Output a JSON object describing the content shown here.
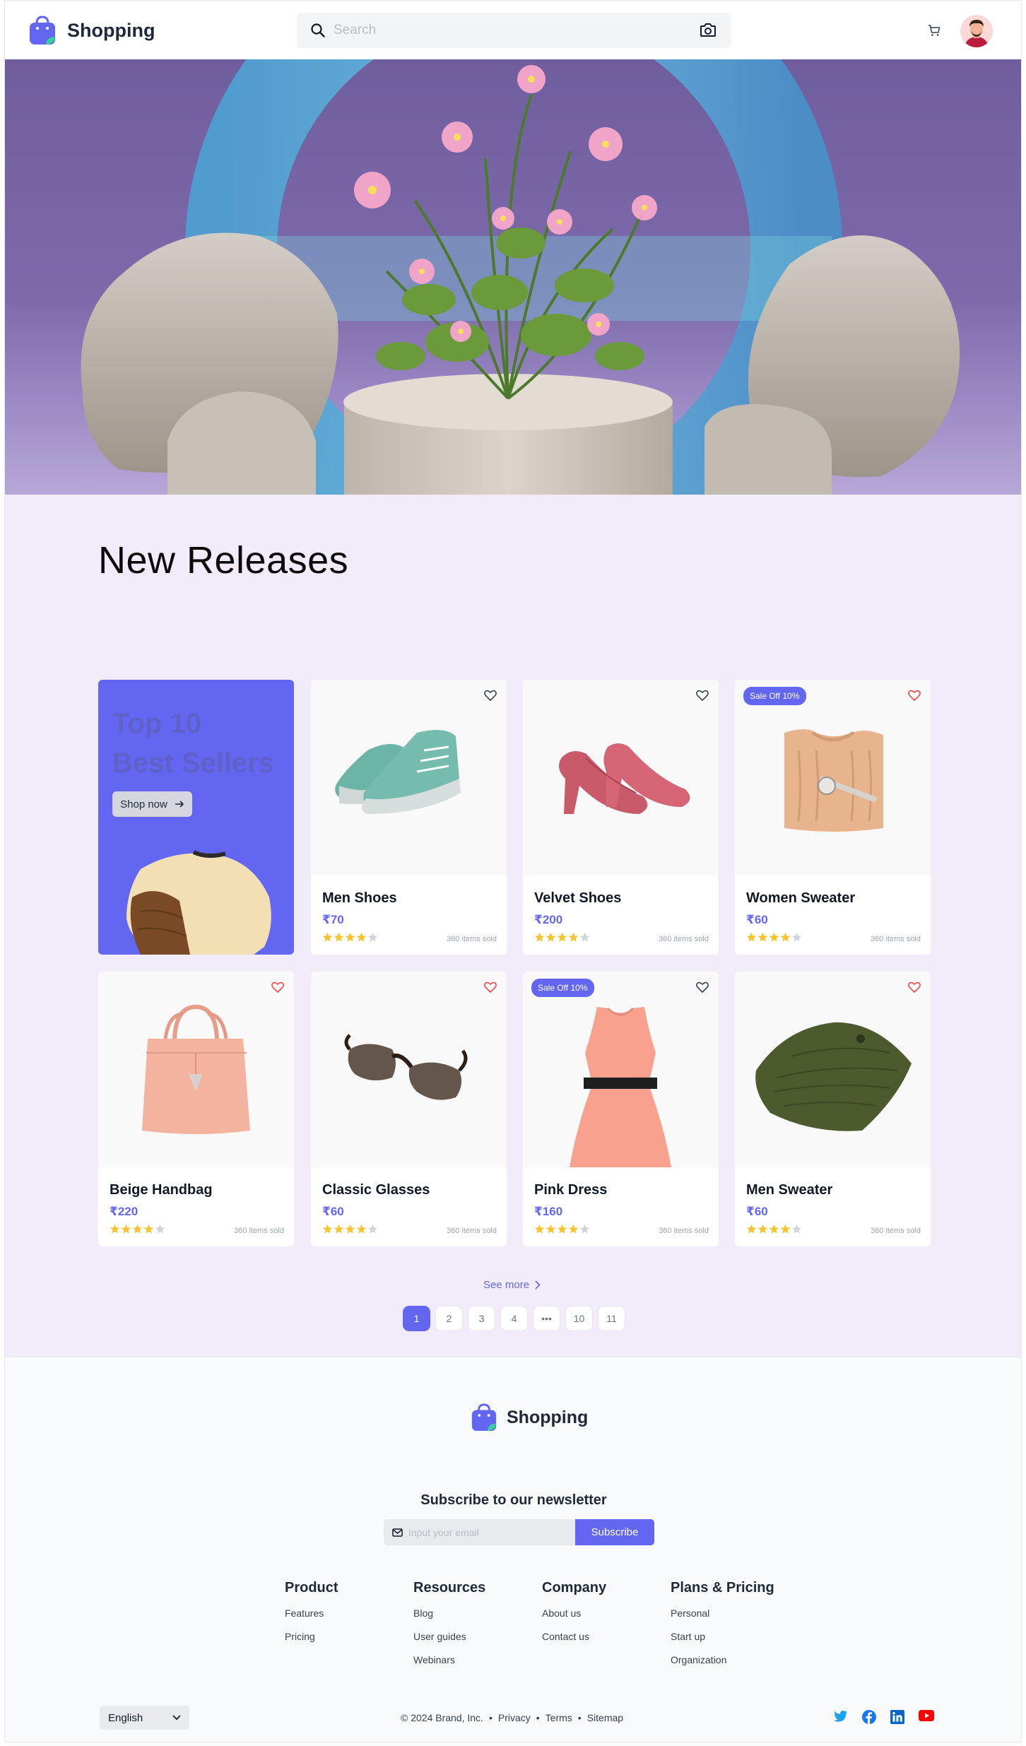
{
  "header": {
    "brand": "Shopping",
    "search_placeholder": "Search"
  },
  "hero": {},
  "releases": {
    "title": "New Releases",
    "promo": {
      "title_line1": "Top 10",
      "title_line2": "Best Sellers",
      "button": "Shop now"
    },
    "products": [
      {
        "name": "Men Shoes",
        "price": "₹70",
        "rating": 4,
        "sold": "360 items sold",
        "badge": "",
        "liked": false
      },
      {
        "name": "Velvet Shoes",
        "price": "₹200",
        "rating": 4,
        "sold": "360 items sold",
        "badge": "",
        "liked": false
      },
      {
        "name": "Women Sweater",
        "price": "₹60",
        "rating": 4,
        "sold": "360 items sold",
        "badge": "Sale Off 10%",
        "liked": true
      },
      {
        "name": "Beige Handbag",
        "price": "₹220",
        "rating": 4,
        "sold": "360 items sold",
        "badge": "",
        "liked": true
      },
      {
        "name": "Classic Glasses",
        "price": "₹60",
        "rating": 4,
        "sold": "360 items sold",
        "badge": "",
        "liked": true
      },
      {
        "name": "Pink Dress",
        "price": "₹160",
        "rating": 4,
        "sold": "360 items sold",
        "badge": "Sale Off 10%",
        "liked": false
      },
      {
        "name": "Men Sweater",
        "price": "₹60",
        "rating": 4,
        "sold": "360 items sold",
        "badge": "",
        "liked": true
      }
    ],
    "see_more": "See more",
    "pages": [
      "1",
      "2",
      "3",
      "4",
      "•••",
      "10",
      "11"
    ],
    "current_page": "1"
  },
  "footer": {
    "brand": "Shopping",
    "newsletter_title": "Subscribe to our newsletter",
    "email_placeholder": "Input your email",
    "subscribe": "Subscribe",
    "columns": [
      {
        "title": "Product",
        "links": [
          "Features",
          "Pricing"
        ]
      },
      {
        "title": "Resources",
        "links": [
          "Blog",
          "User guides",
          "Webinars"
        ]
      },
      {
        "title": "Company",
        "links": [
          "About us",
          "Contact us"
        ]
      },
      {
        "title": "Plans & Pricing",
        "links": [
          "Personal",
          "Start up",
          "Organization"
        ]
      }
    ],
    "language": "English",
    "copyright": "© 2024 Brand, Inc.",
    "legal_links": [
      "Privacy",
      "Terms",
      "Sitemap"
    ],
    "social": [
      "twitter-icon",
      "facebook-icon",
      "linkedin-icon",
      "youtube-icon"
    ]
  },
  "colors": {
    "accent": "#6366f1",
    "page_bg": "#f1ebfa",
    "star": "#f5c431",
    "heart_liked": "#ef4444"
  }
}
